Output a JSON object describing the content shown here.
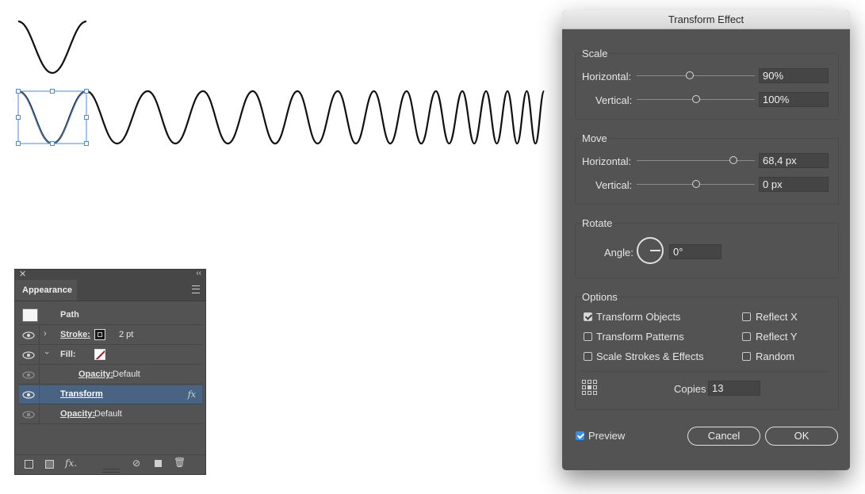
{
  "appearance_panel": {
    "close_icon": "close-icon",
    "collapse_icon": "double-chevron-left-icon",
    "tab_label": "Appearance",
    "menu_icon": "hamburger-menu-icon",
    "header_label": "Path",
    "rows": [
      {
        "label": "Stroke:",
        "value": "2 pt"
      },
      {
        "label": "Fill:"
      },
      {
        "label": "Opacity:",
        "value": "Default"
      },
      {
        "label": "Transform",
        "fx": "fx"
      },
      {
        "label": "Opacity:",
        "value": "Default"
      }
    ],
    "bottom_fx": "fx."
  },
  "dialog": {
    "title": "Transform Effect",
    "scale": {
      "title": "Scale",
      "horizontal_label": "Horizontal:",
      "horizontal_value": "90%",
      "horizontal_level": 0.45,
      "vertical_label": "Vertical:",
      "vertical_value": "100%",
      "vertical_level": 0.5
    },
    "move": {
      "title": "Move",
      "horizontal_label": "Horizontal:",
      "horizontal_value": "68,4 px",
      "horizontal_level": 0.82,
      "vertical_label": "Vertical:",
      "vertical_value": "0 px",
      "vertical_level": 0.5
    },
    "rotate": {
      "title": "Rotate",
      "angle_label": "Angle:",
      "angle_value": "0°"
    },
    "options": {
      "title": "Options",
      "transform_objects": {
        "label": "Transform Objects",
        "checked": true
      },
      "transform_patterns": {
        "label": "Transform Patterns",
        "checked": false
      },
      "scale_strokes": {
        "label": "Scale Strokes & Effects",
        "checked": false
      },
      "reflect_x": {
        "label": "Reflect X",
        "checked": false
      },
      "reflect_y": {
        "label": "Reflect Y",
        "checked": false
      },
      "random": {
        "label": "Random",
        "checked": false
      },
      "copies_label": "Copies",
      "copies_value": "13"
    },
    "preview": {
      "label": "Preview",
      "checked": true
    },
    "cancel_label": "Cancel",
    "ok_label": "OK"
  }
}
